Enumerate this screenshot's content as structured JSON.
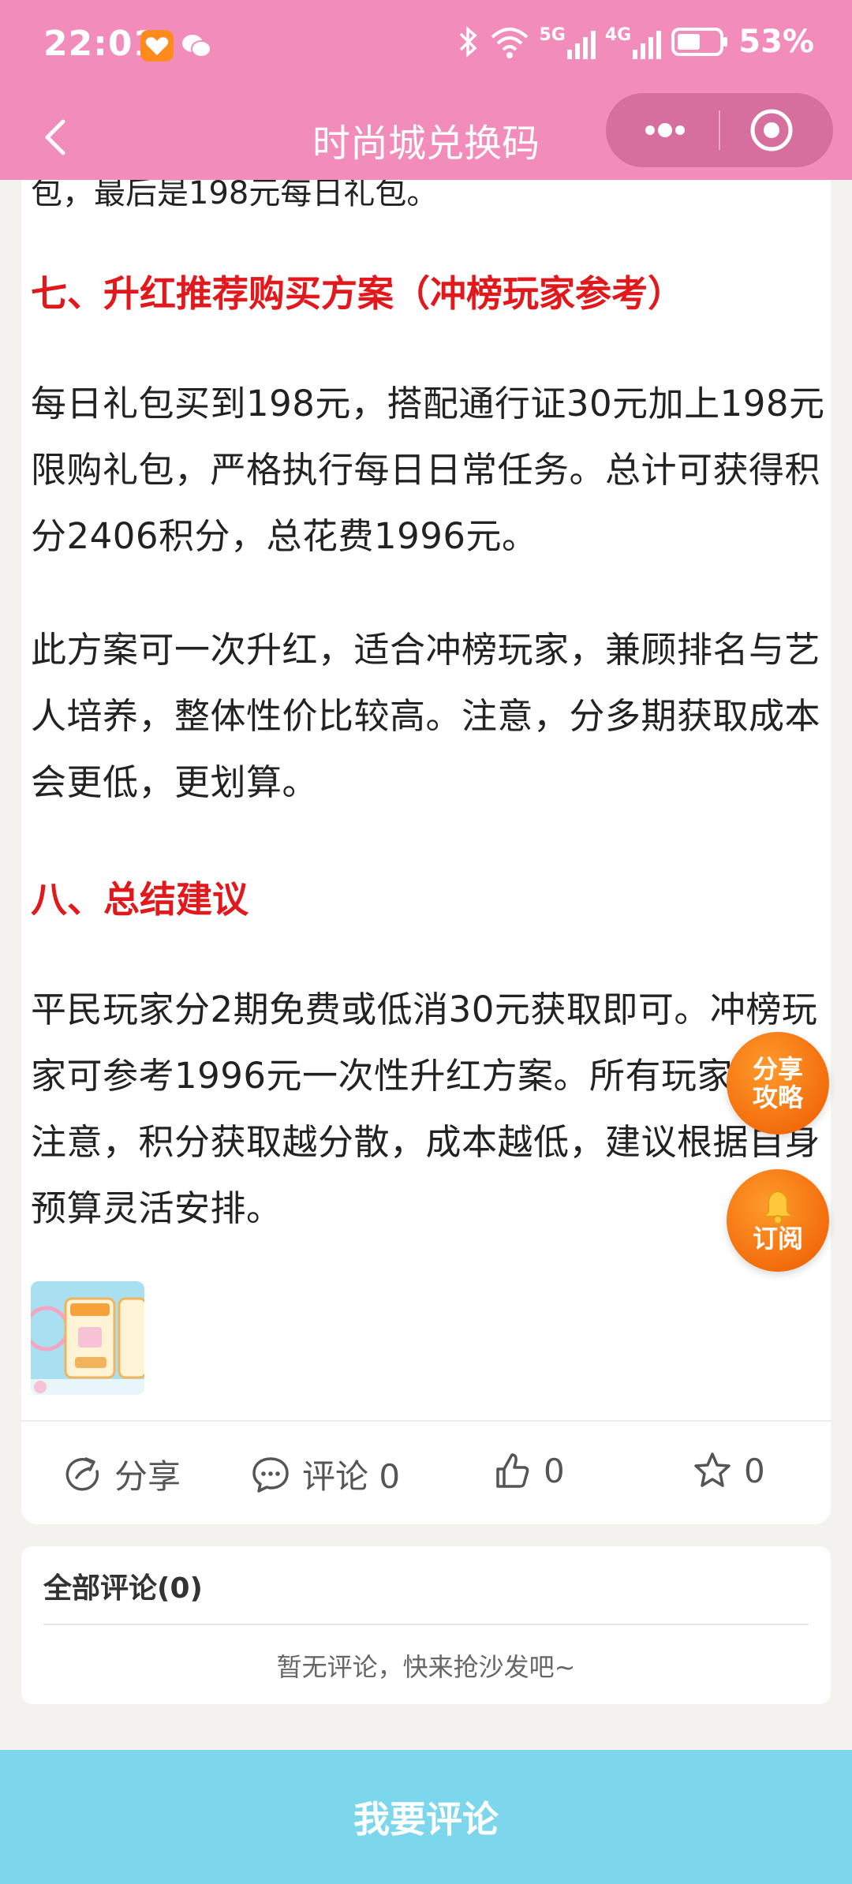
{
  "status_bar": {
    "time": "22:01",
    "battery": "53%",
    "network_1": "5G",
    "network_2": "4G"
  },
  "nav": {
    "title": "时尚城兑换码"
  },
  "article": {
    "cut_text": "包，最后是198元每日礼包。",
    "heading_7": "七、升红推荐购买方案（冲榜玩家参考）",
    "para_7a": "每日礼包买到198元，搭配通行证30元加上198元限购礼包，严格执行每日日常任务。总计可获得积分2406积分，总花费1996元。",
    "para_7b": "此方案可一次升红，适合冲榜玩家，兼顾排名与艺人培养，整体性价比较高。注意，分多期获取成本会更低，更划算。",
    "heading_8": "八、总结建议",
    "para_8": "平民玩家分2期免费或低消30元获取即可。冲榜玩家可参考1996元一次性升红方案。所有玩家均应注意，积分获取越分散，成本越低，建议根据自身预算灵活安排。"
  },
  "actions": {
    "share": "分享",
    "comment": "评论 0",
    "like_count": "0",
    "favorite_count": "0"
  },
  "comments": {
    "title": "全部评论(0)",
    "empty": "暂无评论，快来抢沙发吧~"
  },
  "float": {
    "share_line1": "分享",
    "share_line2": "攻略",
    "subscribe": "订阅"
  },
  "bottom_button": "我要评论",
  "colors": {
    "header_pink": "#f28dbb",
    "heading_red": "#e1181c",
    "bottom_blue": "#7dd7ec",
    "float_orange": "#f36d0c"
  }
}
